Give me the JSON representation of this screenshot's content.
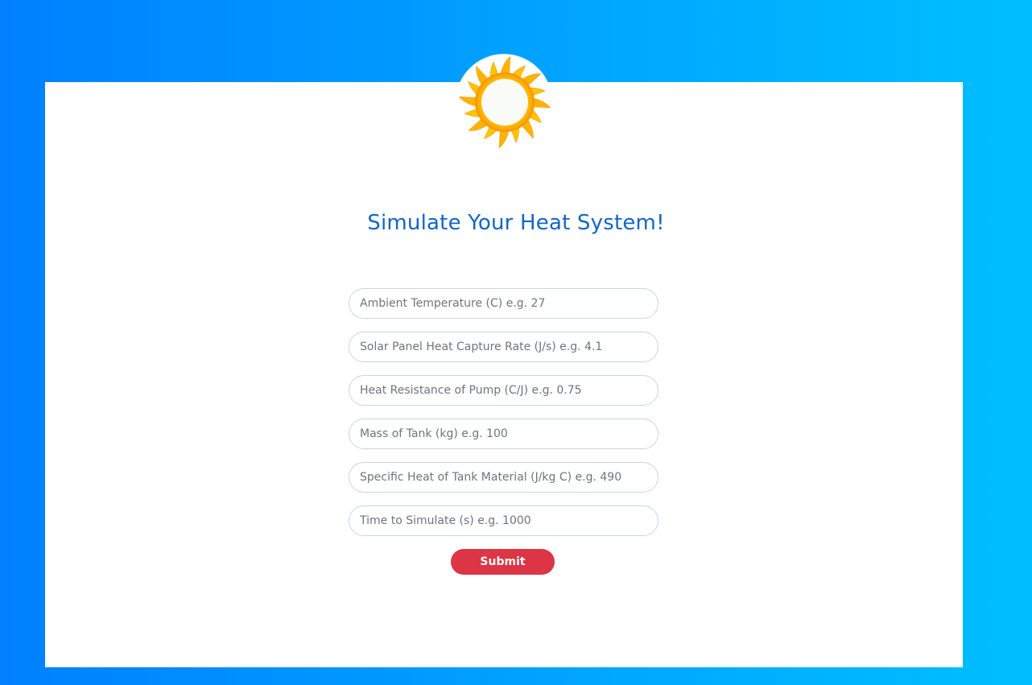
{
  "header": {
    "title": "Simulate Your Heat System!",
    "logo_icon": "sun-icon"
  },
  "form": {
    "fields": [
      {
        "name": "ambient-temperature",
        "placeholder": "Ambient Temperature (C) e.g. 27",
        "value": ""
      },
      {
        "name": "solar-panel-heat-capture-rate",
        "placeholder": "Solar Panel Heat Capture Rate (J/s) e.g. 4.1",
        "value": ""
      },
      {
        "name": "heat-resistance-of-pump",
        "placeholder": "Heat Resistance of Pump (C/J) e.g. 0.75",
        "value": ""
      },
      {
        "name": "mass-of-tank",
        "placeholder": "Mass of Tank (kg) e.g. 100",
        "value": ""
      },
      {
        "name": "specific-heat-of-tank-material",
        "placeholder": "Specific Heat of Tank Material (J/kg C) e.g. 490",
        "value": ""
      },
      {
        "name": "time-to-simulate",
        "placeholder": "Time to Simulate (s) e.g. 1000",
        "value": ""
      }
    ],
    "submit_label": "Submit"
  },
  "colors": {
    "background_start": "#0080ff",
    "background_end": "#00bfff",
    "title": "#1366c4",
    "submit": "#dc3545",
    "sun_outer": "#ffc107",
    "sun_inner": "#fafcfa"
  }
}
